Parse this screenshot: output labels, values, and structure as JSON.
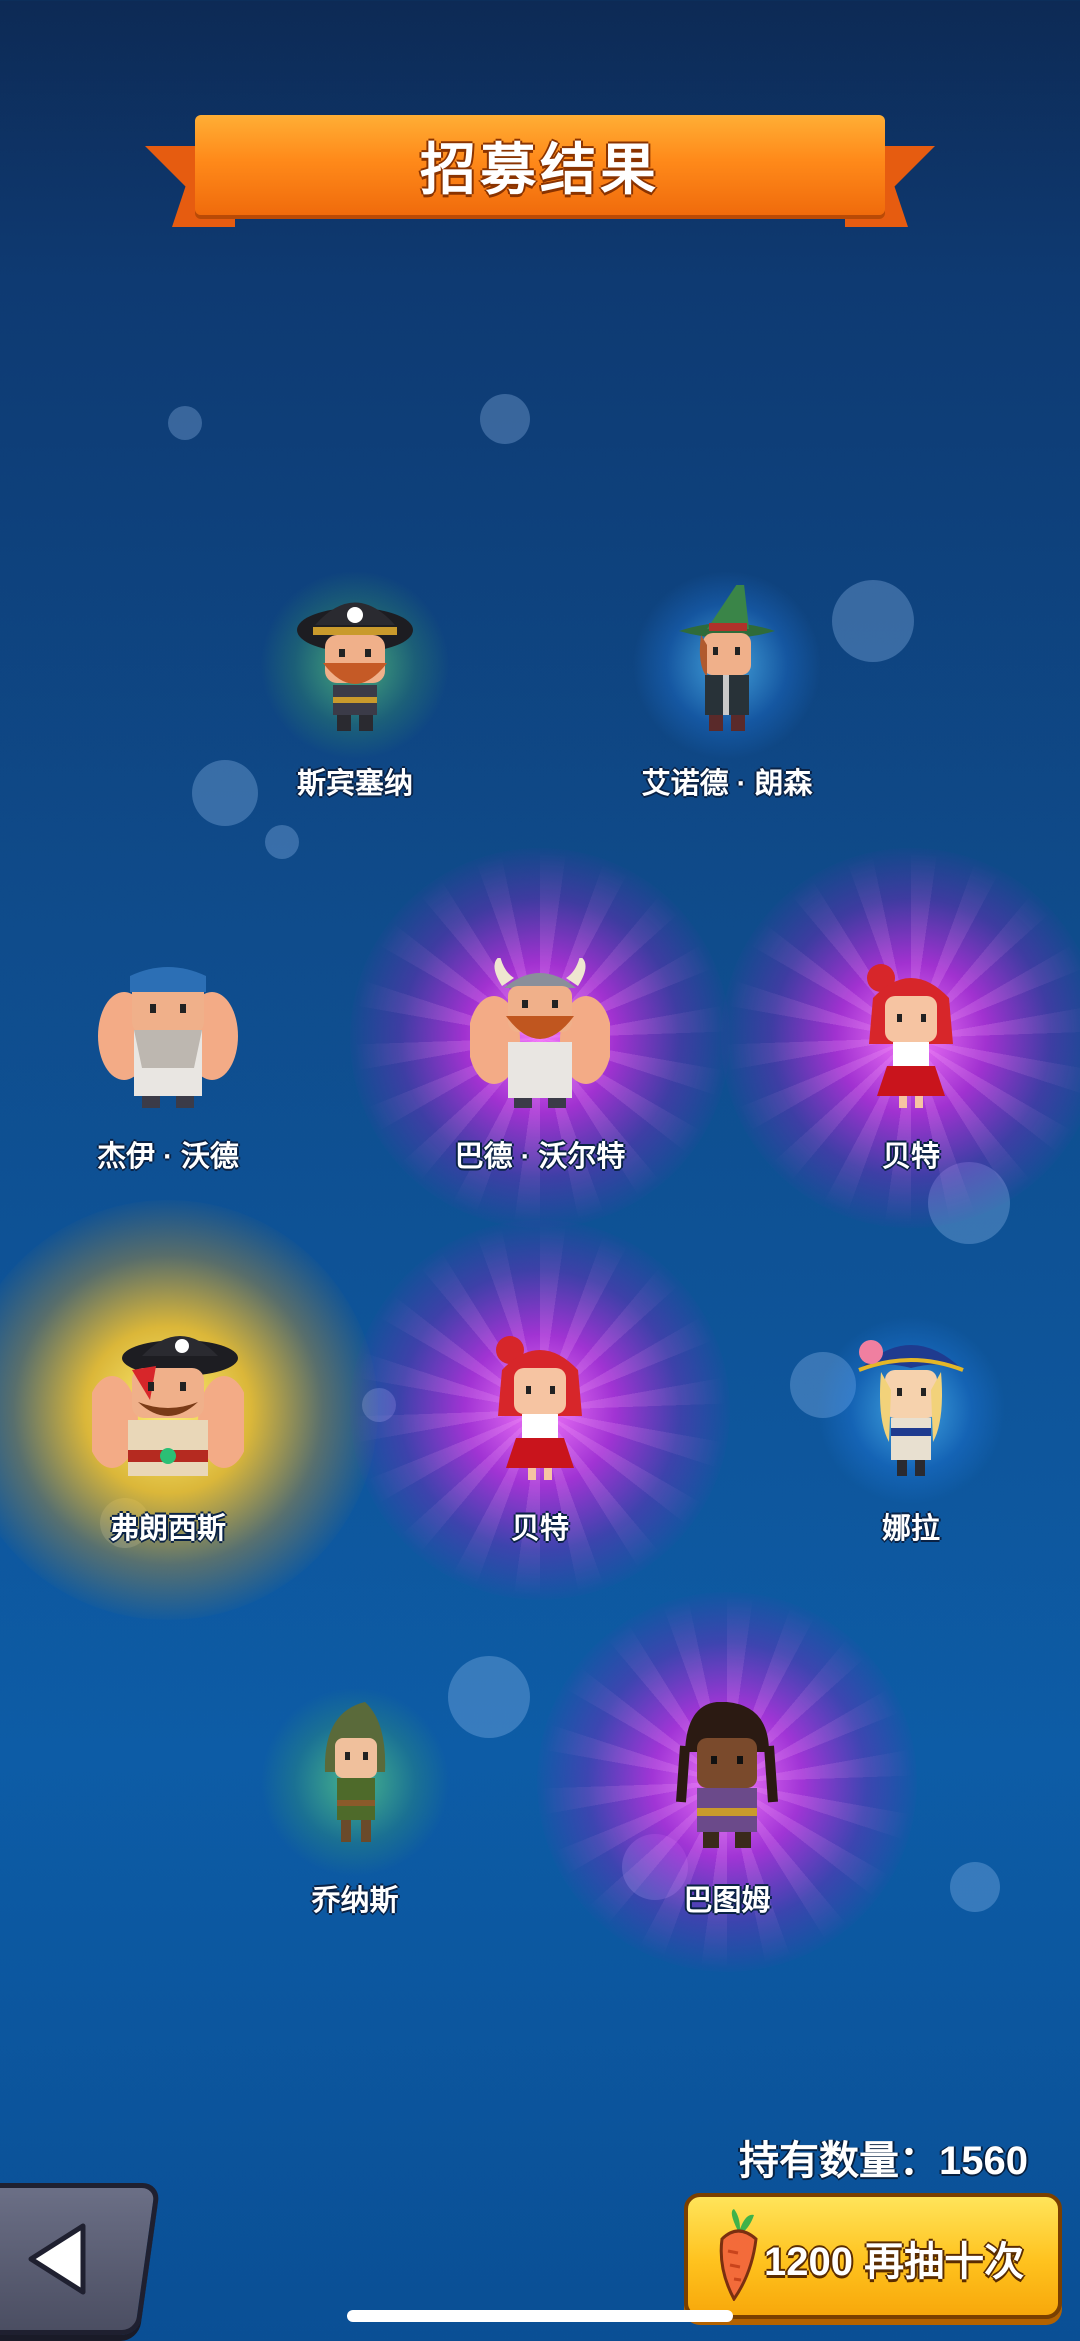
{
  "header": {
    "title": "招募结果"
  },
  "characters": [
    {
      "name": "斯宾塞纳",
      "rarity": "green",
      "icon": "pirate-captain-icon"
    },
    {
      "name": "艾诺德 · 朗森",
      "rarity": "blue",
      "icon": "witch-hat-hero-icon"
    },
    {
      "name": "杰伊 · 沃德",
      "rarity": "none",
      "icon": "sailor-brute-icon"
    },
    {
      "name": "巴德 · 沃尔特",
      "rarity": "purple",
      "icon": "viking-brute-icon"
    },
    {
      "name": "贝特",
      "rarity": "purple",
      "icon": "red-hair-girl-icon"
    },
    {
      "name": "弗朗西斯",
      "rarity": "gold",
      "icon": "pirate-brute-icon"
    },
    {
      "name": "贝特",
      "rarity": "purple",
      "icon": "red-hair-girl-icon"
    },
    {
      "name": "娜拉",
      "rarity": "blue",
      "icon": "tricorn-girl-icon"
    },
    {
      "name": "乔纳斯",
      "rarity": "green",
      "icon": "hooded-scout-icon"
    },
    {
      "name": "巴图姆",
      "rarity": "purple",
      "icon": "dreadlock-hero-icon"
    }
  ],
  "footer": {
    "owned_label": "持有数量：1560",
    "draw_again_label": "1200 再抽十次",
    "back_icon": "back-arrow-icon",
    "currency_icon": "carrot-icon"
  },
  "colors": {
    "background": "#0f4c8c",
    "banner": "#ff8a1a",
    "rarity_green": "#78ff78",
    "rarity_blue": "#5ac8ff",
    "rarity_purple": "#d228e6",
    "rarity_gold": "#ffc828",
    "draw_button": "#ffc21e"
  }
}
